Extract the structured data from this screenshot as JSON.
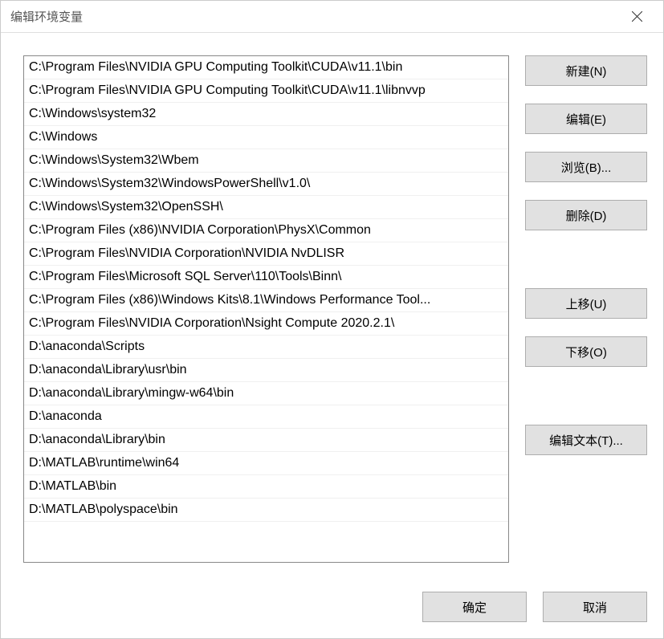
{
  "title": "编辑环境变量",
  "paths": [
    "C:\\Program Files\\NVIDIA GPU Computing Toolkit\\CUDA\\v11.1\\bin",
    "C:\\Program Files\\NVIDIA GPU Computing Toolkit\\CUDA\\v11.1\\libnvvp",
    "C:\\Windows\\system32",
    "C:\\Windows",
    "C:\\Windows\\System32\\Wbem",
    "C:\\Windows\\System32\\WindowsPowerShell\\v1.0\\",
    "C:\\Windows\\System32\\OpenSSH\\",
    "C:\\Program Files (x86)\\NVIDIA Corporation\\PhysX\\Common",
    "C:\\Program Files\\NVIDIA Corporation\\NVIDIA NvDLISR",
    "C:\\Program Files\\Microsoft SQL Server\\110\\Tools\\Binn\\",
    "C:\\Program Files (x86)\\Windows Kits\\8.1\\Windows Performance Tool...",
    "C:\\Program Files\\NVIDIA Corporation\\Nsight Compute 2020.2.1\\",
    "D:\\anaconda\\Scripts",
    "D:\\anaconda\\Library\\usr\\bin",
    "D:\\anaconda\\Library\\mingw-w64\\bin",
    "D:\\anaconda",
    "D:\\anaconda\\Library\\bin",
    "D:\\MATLAB\\runtime\\win64",
    "D:\\MATLAB\\bin",
    "D:\\MATLAB\\polyspace\\bin"
  ],
  "buttons": {
    "new": "新建(N)",
    "edit": "编辑(E)",
    "browse": "浏览(B)...",
    "delete": "删除(D)",
    "moveUp": "上移(U)",
    "moveDown": "下移(O)",
    "editText": "编辑文本(T)...",
    "ok": "确定",
    "cancel": "取消"
  }
}
